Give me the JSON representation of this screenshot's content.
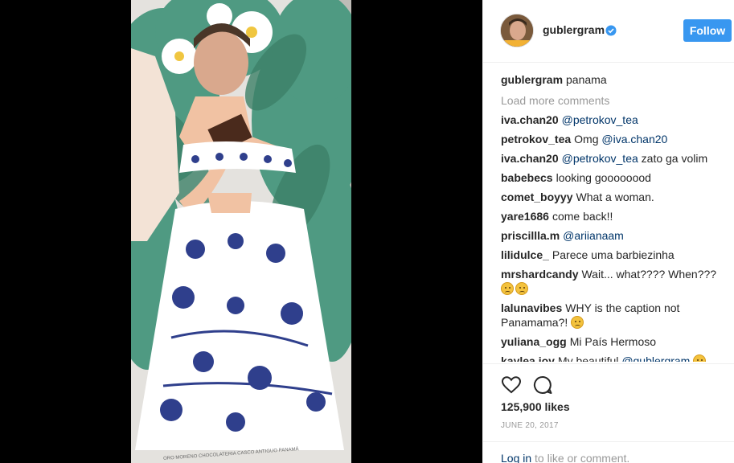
{
  "post": {
    "username": "gublergram",
    "follow_label": "Follow",
    "caption_user": "gublergram",
    "caption_text": "panama",
    "load_more": "Load more comments",
    "likes": "125,900 likes",
    "date": "JUNE 20, 2017",
    "login_link": "Log in",
    "login_rest": "to like or comment.",
    "photo_footer_text": "ORO MORENO CHOCOLATERIA CASCO ANTIGUO PANAMÁ"
  },
  "comments": [
    {
      "user": "iva.chan20",
      "mention": "@petrokov_tea",
      "text": ""
    },
    {
      "user": "petrokov_tea",
      "text": "Omg ",
      "mention": "@iva.chan20"
    },
    {
      "user": "iva.chan20",
      "mention": "@petrokov_tea",
      "text": " zato ga volim"
    },
    {
      "user": "babebecs",
      "text": "looking goooooood"
    },
    {
      "user": "comet_boyyy",
      "text": "What a woman."
    },
    {
      "user": "yare1686",
      "text": "come back!!"
    },
    {
      "user": "priscillla.m",
      "mention": "@ariianaam"
    },
    {
      "user": "lilidulce_",
      "text": "Parece uma barbiezinha"
    },
    {
      "user": "mrshardcandy",
      "text": "Wait... what???? When???"
    },
    {
      "user": "lalunavibes",
      "text": "WHY is the caption not Panamama?!"
    },
    {
      "user": "yuliana_ogg",
      "text": "Mi País Hermoso"
    },
    {
      "user": "kaylea.joy",
      "text": "My beautiful ",
      "mention": "@gublergram"
    }
  ],
  "icons": {
    "verified": "verified-badge-icon",
    "like": "heart-icon",
    "comment": "comment-bubble-icon",
    "emoji_sad": "crying-face-emoji",
    "emoji_frown": "frowning-face-emoji",
    "emoji_heart_eyes": "heart-eyes-emoji"
  },
  "colors": {
    "follow_button": "#3897f0",
    "link": "#003569",
    "muted": "#999999",
    "verified": "#3897f0"
  }
}
